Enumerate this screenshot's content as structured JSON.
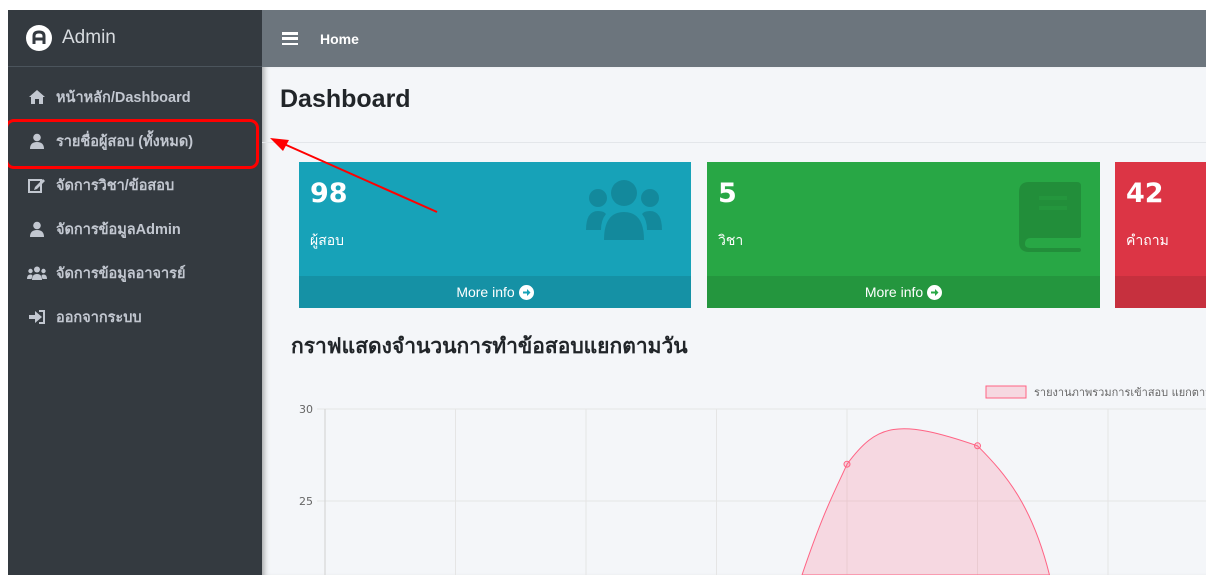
{
  "brand": {
    "name": "Admin",
    "logo_letter": "A"
  },
  "sidebar": {
    "items": [
      {
        "label": "หน้าหลัก/Dashboard",
        "icon": "home-icon"
      },
      {
        "label": "รายชื่อผู้สอบ (ทั้งหมด)",
        "icon": "user-icon",
        "highlighted": true
      },
      {
        "label": "จัดการวิชา/ข้อสอบ",
        "icon": "edit-icon"
      },
      {
        "label": "จัดการข้อมูลAdmin",
        "icon": "user-icon"
      },
      {
        "label": "จัดการข้อมูลอาจารย์",
        "icon": "users-icon"
      },
      {
        "label": "ออกจากระบบ",
        "icon": "sign-out-icon"
      }
    ]
  },
  "topbar": {
    "home_label": "Home",
    "menu_icon": "hamburger-icon"
  },
  "page": {
    "title": "Dashboard"
  },
  "stats": [
    {
      "value": "98",
      "label": "ผู้สอบ",
      "footer": "More info",
      "icon": "users-icon",
      "color": "#17a2b8"
    },
    {
      "value": "5",
      "label": "วิชา",
      "footer": "More info",
      "icon": "book-icon",
      "color": "#28a745"
    },
    {
      "value": "42",
      "label": "คำถาม",
      "footer": "",
      "icon": "",
      "color": "#dc3545"
    }
  ],
  "chart_section": {
    "title": "กราฟแสดงจำนวนการทำข้อสอบแยกตามวัน"
  },
  "chart_data": {
    "type": "area",
    "title": "",
    "xlabel": "",
    "ylabel": "",
    "yticks": [
      30,
      25
    ],
    "ylim": [
      20,
      30
    ],
    "grid": true,
    "legend": "top-right",
    "series": [
      {
        "name": "รายงานภาพรวมการเข้าสอบ แยกตาม",
        "color": "#ff6384",
        "points": [
          {
            "x": 4,
            "y": 27
          },
          {
            "x": 5,
            "y": 28
          }
        ]
      }
    ]
  },
  "annotation": {
    "color": "#ff0000"
  }
}
